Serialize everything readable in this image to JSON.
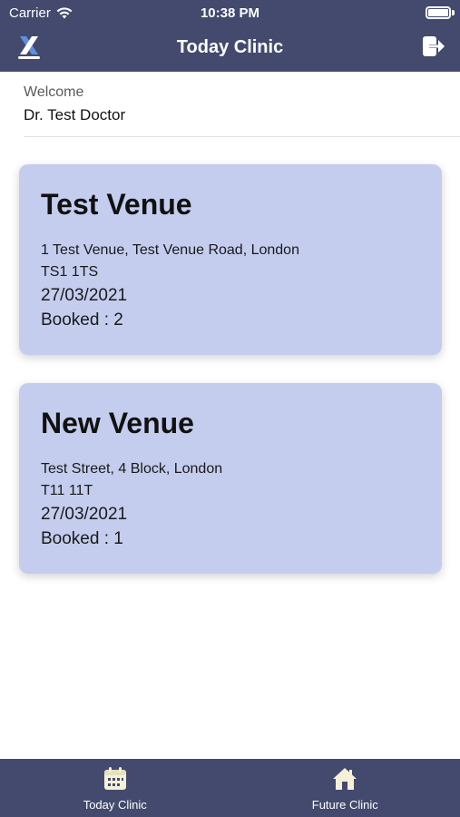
{
  "status_bar": {
    "carrier": "Carrier",
    "time": "10:38 PM"
  },
  "header": {
    "title": "Today Clinic",
    "logo_icon": "xigma-logo-icon",
    "logout_icon": "logout-icon"
  },
  "welcome": {
    "label": "Welcome",
    "name": "Dr. Test Doctor"
  },
  "venues": [
    {
      "name": "Test Venue",
      "address_line1": "1 Test Venue, Test Venue Road, London",
      "address_line2": "TS1 1TS",
      "date": "27/03/2021",
      "booked": "Booked : 2"
    },
    {
      "name": "New Venue",
      "address_line1": "Test Street, 4 Block, London",
      "address_line2": "T11 11T",
      "date": "27/03/2021",
      "booked": "Booked : 1"
    }
  ],
  "tabs": [
    {
      "label": "Today Clinic",
      "icon": "calendar-icon"
    },
    {
      "label": "Future Clinic",
      "icon": "home-icon"
    }
  ],
  "colors": {
    "bar": "#434a6e",
    "card": "#c4cdee",
    "icon_cream": "#f5f0d8"
  }
}
